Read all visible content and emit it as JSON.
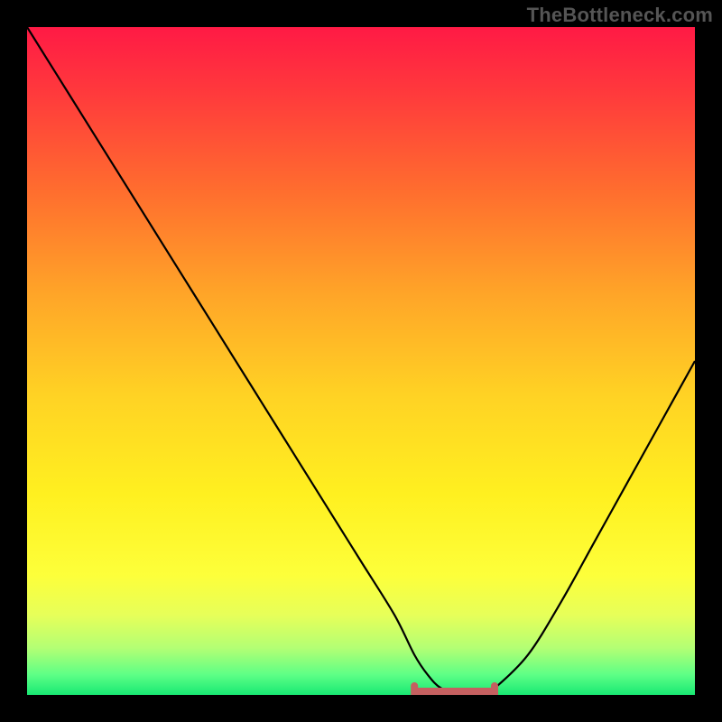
{
  "watermark": "TheBottleneck.com",
  "chart_data": {
    "type": "line",
    "title": "",
    "xlabel": "",
    "ylabel": "",
    "xlim": [
      0,
      100
    ],
    "ylim": [
      0,
      100
    ],
    "grid": false,
    "legend": false,
    "series": [
      {
        "name": "bottleneck-curve",
        "x": [
          0,
          5,
          10,
          15,
          20,
          25,
          30,
          35,
          40,
          45,
          50,
          55,
          58,
          60,
          62,
          65,
          68,
          70,
          75,
          80,
          85,
          90,
          95,
          100
        ],
        "values": [
          100,
          92,
          84,
          76,
          68,
          60,
          52,
          44,
          36,
          28,
          20,
          12,
          6,
          3,
          1,
          0,
          0,
          1,
          6,
          14,
          23,
          32,
          41,
          50
        ]
      }
    ],
    "optimal_range": {
      "x_start": 58,
      "x_end": 70,
      "value": 0
    },
    "gradient_stops": [
      {
        "offset": 0.0,
        "color": "#ff1a45"
      },
      {
        "offset": 0.1,
        "color": "#ff3a3c"
      },
      {
        "offset": 0.25,
        "color": "#ff6f2e"
      },
      {
        "offset": 0.4,
        "color": "#ffa528"
      },
      {
        "offset": 0.55,
        "color": "#ffd224"
      },
      {
        "offset": 0.7,
        "color": "#fff020"
      },
      {
        "offset": 0.82,
        "color": "#fdff3a"
      },
      {
        "offset": 0.88,
        "color": "#e7ff59"
      },
      {
        "offset": 0.93,
        "color": "#b3ff74"
      },
      {
        "offset": 0.97,
        "color": "#5dff86"
      },
      {
        "offset": 1.0,
        "color": "#18e873"
      }
    ]
  }
}
